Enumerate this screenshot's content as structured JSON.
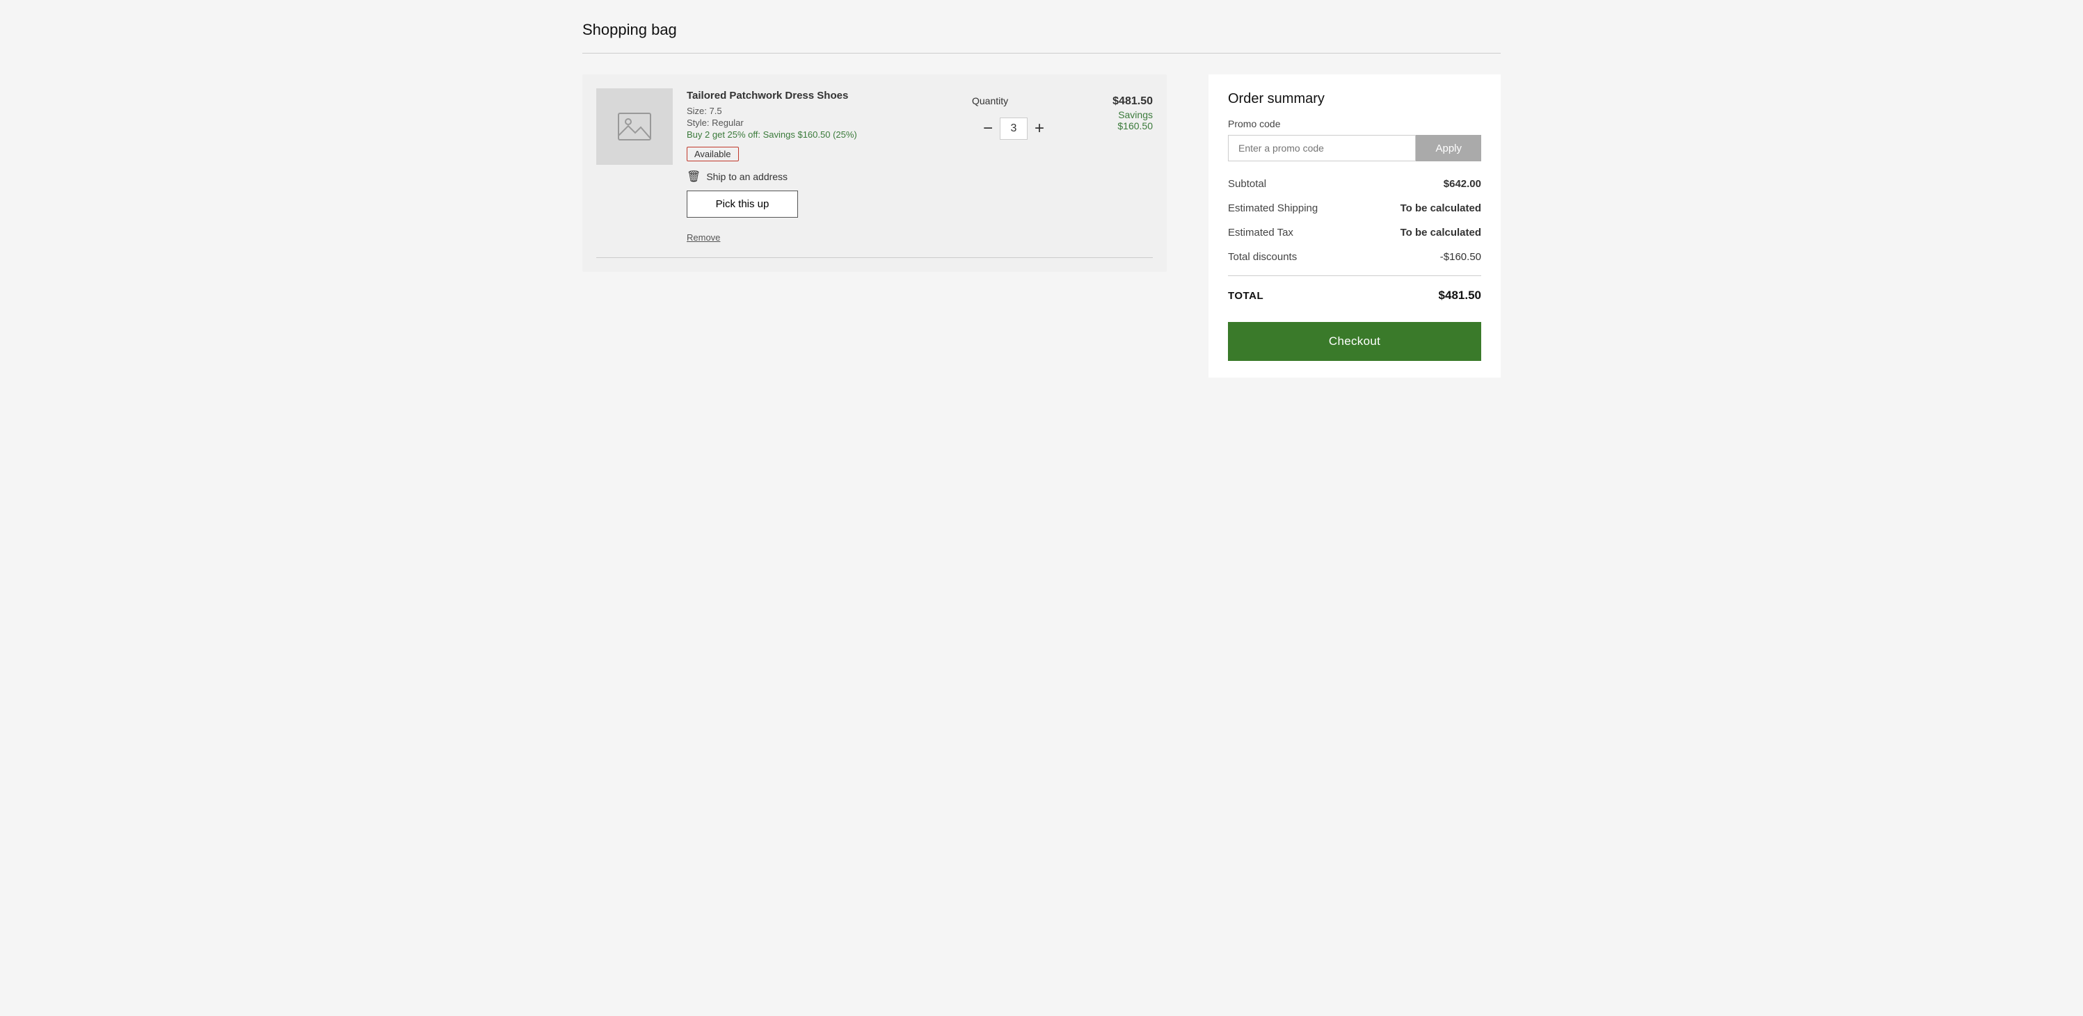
{
  "page": {
    "title": "Shopping bag"
  },
  "cart": {
    "item": {
      "name": "Tailored Patchwork Dress Shoes",
      "size": "Size: 7.5",
      "style": "Style: Regular",
      "promo": "Buy 2 get 25% off: Savings $160.50 (25%)",
      "availability": "Available",
      "shipping_option": "Ship to an address",
      "pick_up_label": "Pick this up",
      "remove_label": "Remove",
      "quantity_label": "Quantity",
      "quantity": "3",
      "price": "$481.50",
      "savings_label": "Savings",
      "savings_amount": "$160.50"
    }
  },
  "order_summary": {
    "title": "Order summary",
    "promo_label": "Promo code",
    "promo_placeholder": "Enter a promo code",
    "apply_label": "Apply",
    "subtotal_label": "Subtotal",
    "subtotal_value": "$642.00",
    "shipping_label": "Estimated Shipping",
    "shipping_value": "To be calculated",
    "tax_label": "Estimated Tax",
    "tax_value": "To be calculated",
    "discounts_label": "Total discounts",
    "discounts_value": "-$160.50",
    "total_label": "TOTAL",
    "total_value": "$481.50",
    "checkout_label": "Checkout"
  }
}
